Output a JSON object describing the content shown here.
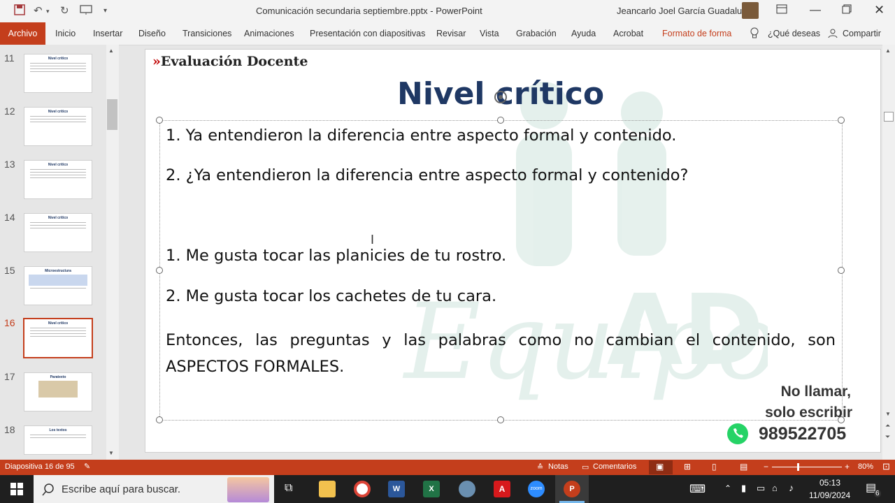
{
  "window": {
    "doc_title": "Comunicación secundaria septiembre.pptx  -  PowerPoint",
    "user_name": "Jeancarlo Joel García Guadalupe"
  },
  "ribbon": {
    "tabs": [
      "Archivo",
      "Inicio",
      "Insertar",
      "Diseño",
      "Transiciones",
      "Animaciones",
      "Presentación con diapositivas",
      "Revisar",
      "Vista",
      "Grabación",
      "Ayuda",
      "Acrobat",
      "Formato de forma"
    ],
    "tell_me": "¿Qué deseas",
    "share": "Compartir"
  },
  "thumbnails": [
    {
      "num": "11",
      "title": "Nivel crítico"
    },
    {
      "num": "12",
      "title": "Nivel crítico"
    },
    {
      "num": "13",
      "title": "Nivel crítico"
    },
    {
      "num": "14",
      "title": "Nivel crítico"
    },
    {
      "num": "15",
      "title": "Microestructura"
    },
    {
      "num": "16",
      "title": "Nivel crítico"
    },
    {
      "num": "17",
      "title": "Paratexto"
    },
    {
      "num": "18",
      "title": "Los textos"
    }
  ],
  "slide": {
    "brand": "Evaluación Docente",
    "title": "Nivel crítico",
    "lines": [
      "1. Ya entendieron la diferencia entre aspecto formal y contenido.",
      "2. ¿Ya entendieron la diferencia entre aspecto formal y contenido?",
      "1. Me gusta tocar las planicies de tu rostro.",
      "2. Me gusta tocar los cachetes de tu cara."
    ],
    "conclusion": "Entonces, las preguntas y las palabras como no cambian el contenido, son ASPECTOS FORMALES.",
    "contact_line1": "No llamar,",
    "contact_line2": "solo escribir",
    "phone": "989522705"
  },
  "status": {
    "slide_counter": "Diapositiva 16 de 95",
    "notes": "Notas",
    "comments": "Comentarios",
    "zoom": "80%"
  },
  "taskbar": {
    "search_placeholder": "Escribe aquí para buscar.",
    "time": "05:13",
    "date": "11/09/2024",
    "notification_count": "6"
  },
  "colors": {
    "accent": "#c43e1c",
    "title_navy": "#1f3864",
    "brand_red": "#c00000",
    "whatsapp": "#25d366"
  }
}
